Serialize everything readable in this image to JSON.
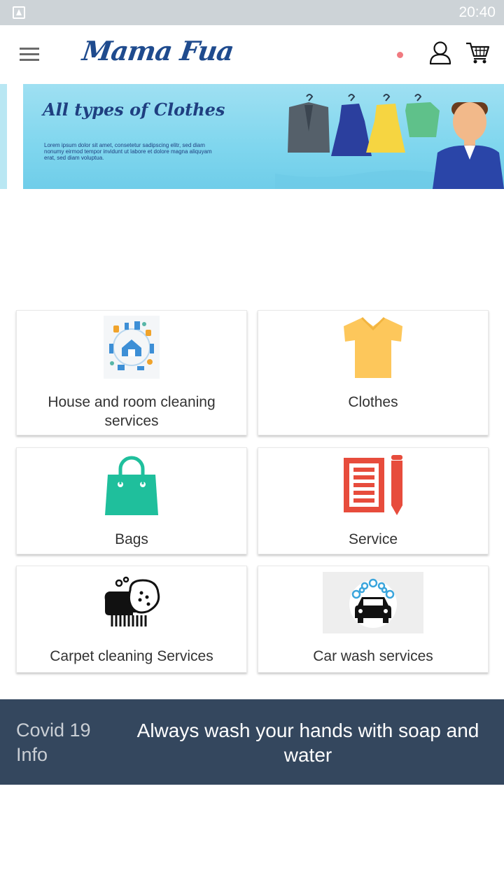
{
  "status_bar": {
    "time": "20:40"
  },
  "header": {
    "brand": "Mama Fua"
  },
  "banner": {
    "title": "All types of Clothes",
    "lorem": "Lorem ipsum dolor sit amet, consetetur sadipscing elitr, sed diam nonumy eirmod tempor invidunt ut labore et dolore magna aliquyam erat, sed diam voluptua."
  },
  "services": [
    {
      "label": "House and room cleaning services",
      "icon": "house-cleaning-icon"
    },
    {
      "label": "Clothes",
      "icon": "tshirt-icon"
    },
    {
      "label": "Bags",
      "icon": "shopping-bag-icon"
    },
    {
      "label": "Service",
      "icon": "document-pencil-icon"
    },
    {
      "label": "Carpet cleaning Services",
      "icon": "carpet-cleaning-icon"
    },
    {
      "label": "Car wash services",
      "icon": "car-wash-icon"
    }
  ],
  "covid": {
    "title": "Covid 19 Info",
    "message": "Always wash your hands with soap and water"
  },
  "colors": {
    "brand": "#1f4b8e",
    "covid_bg": "#34475e",
    "tshirt": "#fdc75b",
    "bag": "#1fbf9c",
    "document": "#e74c3c"
  }
}
